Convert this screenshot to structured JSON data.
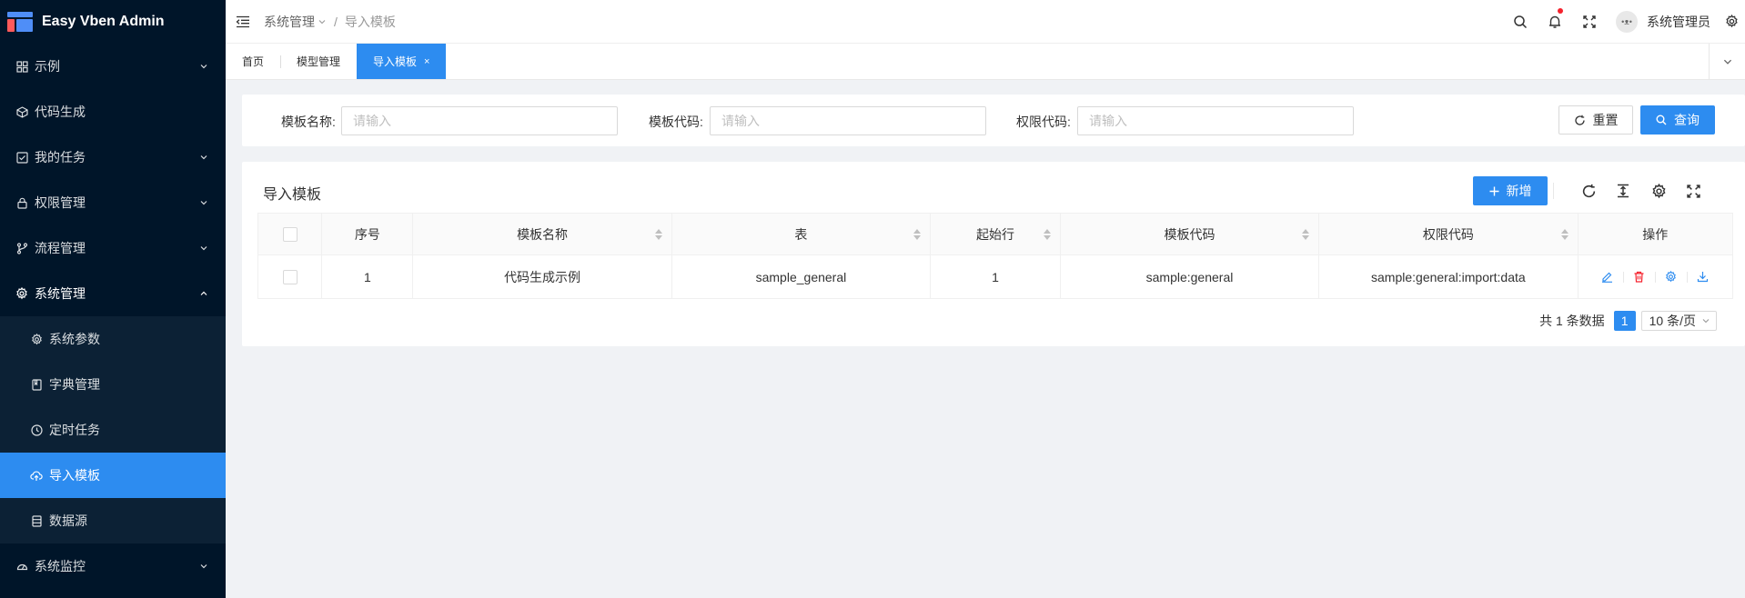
{
  "app": {
    "title": "Easy Vben Admin"
  },
  "colors": {
    "primary": "#2d8cf0",
    "sidebar_bg": "#001529",
    "danger": "#f5222d"
  },
  "sidebar": {
    "items": [
      {
        "label": "示例",
        "icon": "grid-icon"
      },
      {
        "label": "代码生成",
        "icon": "cube-icon"
      },
      {
        "label": "我的任务",
        "icon": "checkbox-icon"
      },
      {
        "label": "权限管理",
        "icon": "lock-icon"
      },
      {
        "label": "流程管理",
        "icon": "branch-icon"
      },
      {
        "label": "系统管理",
        "icon": "gear-icon"
      },
      {
        "label": "系统监控",
        "icon": "dashboard-icon"
      }
    ],
    "submenu": [
      {
        "label": "系统参数",
        "icon": "gear-icon"
      },
      {
        "label": "字典管理",
        "icon": "book-icon"
      },
      {
        "label": "定时任务",
        "icon": "clock-icon"
      },
      {
        "label": "导入模板",
        "icon": "cloud-upload-icon"
      },
      {
        "label": "数据源",
        "icon": "database-icon"
      }
    ]
  },
  "header": {
    "breadcrumb": [
      "系统管理",
      "导入模板"
    ],
    "user_name": "系统管理员",
    "avatar_text": "•ᴥ•"
  },
  "tabs": [
    {
      "label": "首页"
    },
    {
      "label": "模型管理"
    },
    {
      "label": "导入模板",
      "close": "×"
    }
  ],
  "search": {
    "fields": [
      {
        "label": "模板名称:",
        "placeholder": "请输入",
        "value": ""
      },
      {
        "label": "模板代码:",
        "placeholder": "请输入",
        "value": ""
      },
      {
        "label": "权限代码:",
        "placeholder": "请输入",
        "value": ""
      }
    ],
    "reset_label": "重置",
    "query_label": "查询"
  },
  "table": {
    "title": "导入模板",
    "add_label": "新增",
    "columns": [
      "序号",
      "模板名称",
      "表",
      "起始行",
      "模板代码",
      "权限代码",
      "操作"
    ],
    "rows": [
      [
        "1",
        "代码生成示例",
        "sample_general",
        "1",
        "sample:general",
        "sample:general:import:data"
      ]
    ],
    "row_actions": [
      "edit-icon",
      "delete-icon",
      "settings-icon",
      "download-icon"
    ]
  },
  "pagination": {
    "total_text": "共 1 条数据",
    "current_page": "1",
    "page_size": "10 条/页"
  }
}
